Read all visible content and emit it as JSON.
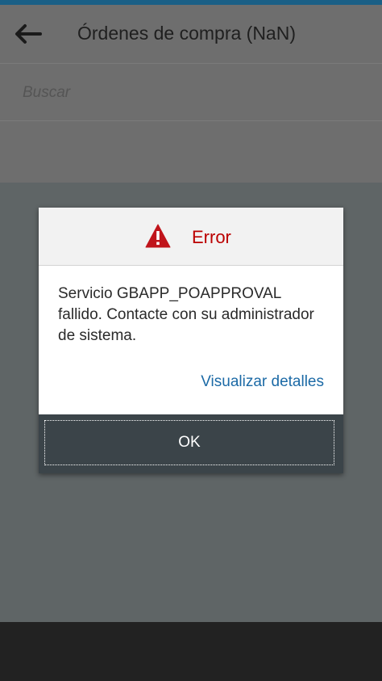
{
  "header": {
    "title": "Órdenes de compra (NaN)",
    "back_icon": "arrow-left-icon"
  },
  "search": {
    "placeholder": "Buscar"
  },
  "dialog": {
    "title": "Error",
    "icon": "warning-icon",
    "message": "Servicio GBAPP_POAPPROVAL fallido. Contacte con su administrador de sistema.",
    "details_link": "Visualizar detalles",
    "ok_label": "OK"
  },
  "colors": {
    "accent": "#1a5f86",
    "error": "#bb0000",
    "link": "#1c6aa6",
    "footer": "#3b4449"
  }
}
